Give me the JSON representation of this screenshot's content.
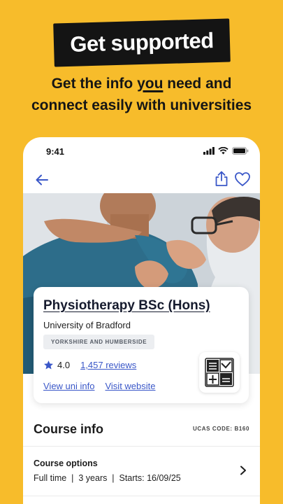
{
  "promo": {
    "badge": "Get supported",
    "headline_line1_a": "Get the info ",
    "headline_line1_em": "you",
    "headline_line1_b": " need and",
    "headline_line2": "connect easily with universities"
  },
  "status_bar": {
    "time": "9:41"
  },
  "course": {
    "title": "Physiotherapy BSc (Hons)",
    "university": "University of Bradford",
    "region": "YORKSHIRE AND HUMBERSIDE",
    "rating": "4.0",
    "reviews": "1,457 reviews",
    "view_uni_label": "View uni info",
    "visit_website_label": "Visit website"
  },
  "course_info": {
    "heading": "Course info",
    "ucas_code": "UCAS CODE: B160",
    "options_label": "Course options",
    "options_details": "Full time  |  3 years  |  Starts: 16/09/25"
  },
  "colors": {
    "background": "#F7BC2B",
    "link": "#3a57c8",
    "accent_icon": "#3a57c8",
    "badge_bg": "#141414"
  }
}
